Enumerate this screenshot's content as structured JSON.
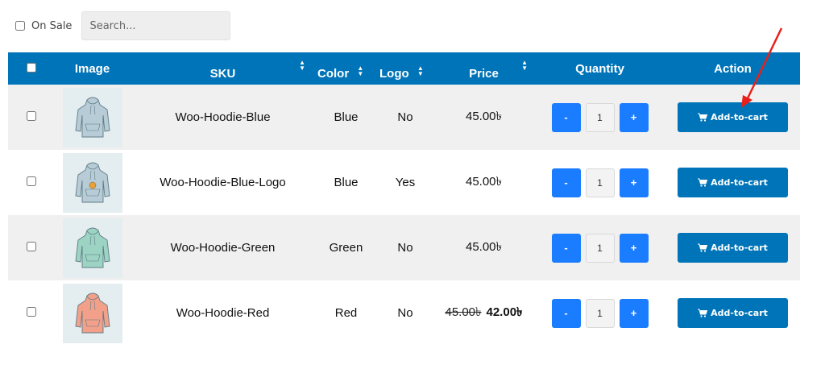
{
  "filters": {
    "on_sale_label": "On Sale",
    "search_placeholder": "Search..."
  },
  "table": {
    "headers": {
      "image": "Image",
      "sku": "SKU",
      "color": "Color",
      "logo": "Logo",
      "price": "Price",
      "quantity": "Quantity",
      "action": "Action"
    },
    "rows": [
      {
        "sku": "Woo-Hoodie-Blue",
        "color": "Blue",
        "logo": "No",
        "price": "45.00৳",
        "old_price": "",
        "sale_price": "",
        "qty": "1",
        "hoodie_color": "#b7ccd6",
        "has_logo": false
      },
      {
        "sku": "Woo-Hoodie-Blue-Logo",
        "color": "Blue",
        "logo": "Yes",
        "price": "45.00৳",
        "old_price": "",
        "sale_price": "",
        "qty": "1",
        "hoodie_color": "#b7ccd6",
        "has_logo": true
      },
      {
        "sku": "Woo-Hoodie-Green",
        "color": "Green",
        "logo": "No",
        "price": "45.00৳",
        "old_price": "",
        "sale_price": "",
        "qty": "1",
        "hoodie_color": "#9cd3c2",
        "has_logo": false
      },
      {
        "sku": "Woo-Hoodie-Red",
        "color": "Red",
        "logo": "No",
        "price": "",
        "old_price": "45.00৳",
        "sale_price": "42.00৳",
        "qty": "1",
        "hoodie_color": "#f2a08a",
        "has_logo": false
      }
    ],
    "minus_label": "-",
    "plus_label": "+",
    "add_to_cart_label": "Add-to-cart"
  },
  "colors": {
    "header_bg": "#0074b8",
    "qty_button": "#1a7cff",
    "annotation_arrow": "#e8201c"
  },
  "icons": [
    "sort-icon",
    "cart-icon",
    "hoodie-image",
    "annotation-arrow"
  ]
}
